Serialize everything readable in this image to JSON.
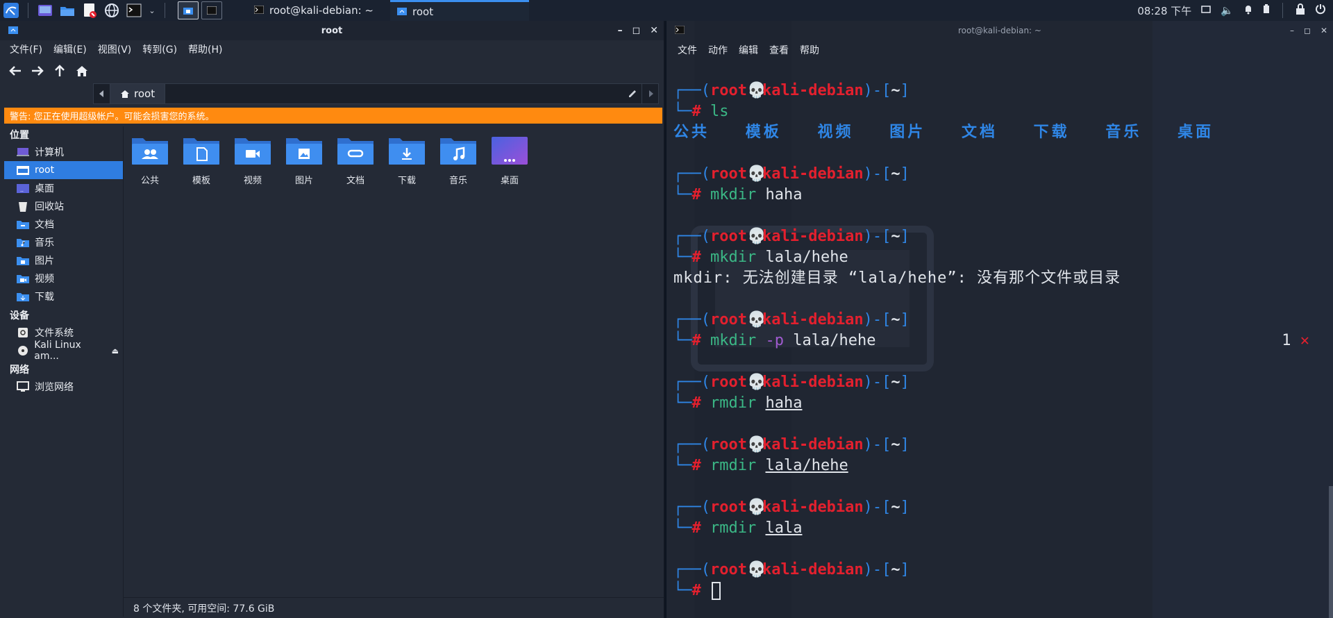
{
  "panel": {
    "tasks": [
      {
        "label": "root@kali-debian: ~",
        "icon": "terminal-icon"
      },
      {
        "label": "root",
        "icon": "home-icon"
      }
    ],
    "clock": "08:28 下午"
  },
  "file_manager": {
    "title": "root",
    "menu": [
      "文件(F)",
      "编辑(E)",
      "视图(V)",
      "转到(G)",
      "帮助(H)"
    ],
    "path": "root",
    "warning": "警告: 您正在使用超级帐户。可能会损害您的系统。",
    "sidebar": {
      "places_header": "位置",
      "places": [
        {
          "label": "计算机",
          "icon": "computer-icon"
        },
        {
          "label": "root",
          "icon": "home-folder-icon"
        },
        {
          "label": "桌面",
          "icon": "desktop-icon"
        },
        {
          "label": "回收站",
          "icon": "trash-icon"
        },
        {
          "label": "文档",
          "icon": "documents-icon"
        },
        {
          "label": "音乐",
          "icon": "music-icon"
        },
        {
          "label": "图片",
          "icon": "pictures-icon"
        },
        {
          "label": "视频",
          "icon": "videos-icon"
        },
        {
          "label": "下载",
          "icon": "downloads-icon"
        }
      ],
      "devices_header": "设备",
      "devices": [
        {
          "label": "文件系统",
          "icon": "filesystem-icon"
        },
        {
          "label": "Kali Linux am...",
          "icon": "disc-icon"
        }
      ],
      "network_header": "网络",
      "network": [
        {
          "label": "浏览网络",
          "icon": "network-icon"
        }
      ]
    },
    "folders": [
      {
        "label": "公共",
        "icon": "public-folder-icon"
      },
      {
        "label": "模板",
        "icon": "templates-folder-icon"
      },
      {
        "label": "视频",
        "icon": "videos-folder-icon"
      },
      {
        "label": "图片",
        "icon": "pictures-folder-icon"
      },
      {
        "label": "文档",
        "icon": "documents-folder-icon"
      },
      {
        "label": "下载",
        "icon": "downloads-folder-icon"
      },
      {
        "label": "音乐",
        "icon": "music-folder-icon"
      },
      {
        "label": "桌面",
        "icon": "desktop-folder-icon"
      }
    ],
    "status": "8 个文件夹, 可用空间: 77.6 GiB"
  },
  "terminal": {
    "title": "root@kali-debian: ~",
    "menu": [
      "文件",
      "动作",
      "编辑",
      "查看",
      "帮助"
    ],
    "prompt": {
      "user": "root",
      "host": "kali-debian",
      "dir": "~",
      "symbol": "#"
    },
    "ls_output": "公共   模板   视频   图片   文档   下载   音乐   桌面",
    "commands": [
      {
        "cmd": "ls",
        "opt": "",
        "args": "",
        "underline": false
      },
      {
        "cmd": "mkdir",
        "opt": "",
        "args": "haha",
        "underline": false
      },
      {
        "cmd": "mkdir",
        "opt": "",
        "args": "lala/hehe",
        "underline": false
      },
      {
        "cmd": "mkdir",
        "opt": "-p",
        "args": "lala/hehe",
        "underline": false
      },
      {
        "cmd": "rmdir",
        "opt": "",
        "args": "haha",
        "underline": true
      },
      {
        "cmd": "rmdir",
        "opt": "",
        "args": "lala/hehe",
        "underline": true
      },
      {
        "cmd": "rmdir",
        "opt": "",
        "args": "lala",
        "underline": true
      }
    ],
    "error_output": "mkdir: 无法创建目录 “lala/hehe”: 没有那个文件或目录",
    "exit_status": "1",
    "exit_mark": "✕"
  },
  "colors": {
    "accent": "#2f7de1",
    "warning": "#ff8a10",
    "prompt_red": "#e3202e",
    "prompt_blue": "#2f86e6",
    "command_green": "#3bb886"
  }
}
